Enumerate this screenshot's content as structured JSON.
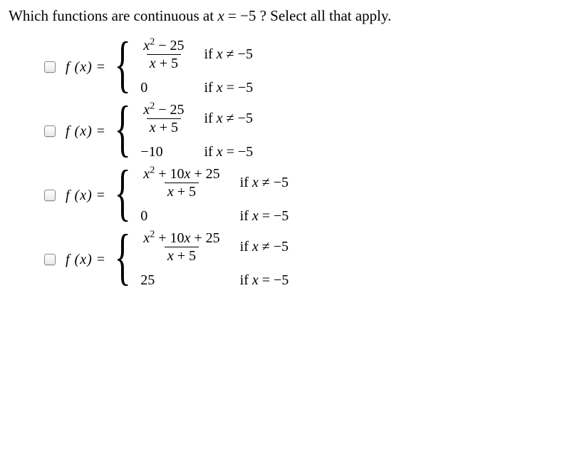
{
  "question_prefix": "Which functions are continuous at ",
  "question_var": "x",
  "question_val": " = −5",
  "question_suffix": " ? Select all that apply.",
  "options": [
    {
      "numerator": "x² − 25",
      "denominator": "x + 5",
      "cond1": "if x ≠ −5",
      "value2": "0",
      "cond2": "if x = −5",
      "checked": false
    },
    {
      "numerator": "x² − 25",
      "denominator": "x + 5",
      "cond1": "if x ≠ −5",
      "value2": "−10",
      "cond2": "if x = −5",
      "checked": false
    },
    {
      "numerator": "x² + 10x + 25",
      "denominator": "x + 5",
      "cond1": "if x ≠ −5",
      "value2": "0",
      "cond2": "if x = −5",
      "checked": false
    },
    {
      "numerator": "x² + 10x + 25",
      "denominator": "x + 5",
      "cond1": "if x ≠ −5",
      "value2": "25",
      "cond2": "if x = −5",
      "checked": false
    }
  ],
  "fx_label": "f (x)",
  "equals": "="
}
